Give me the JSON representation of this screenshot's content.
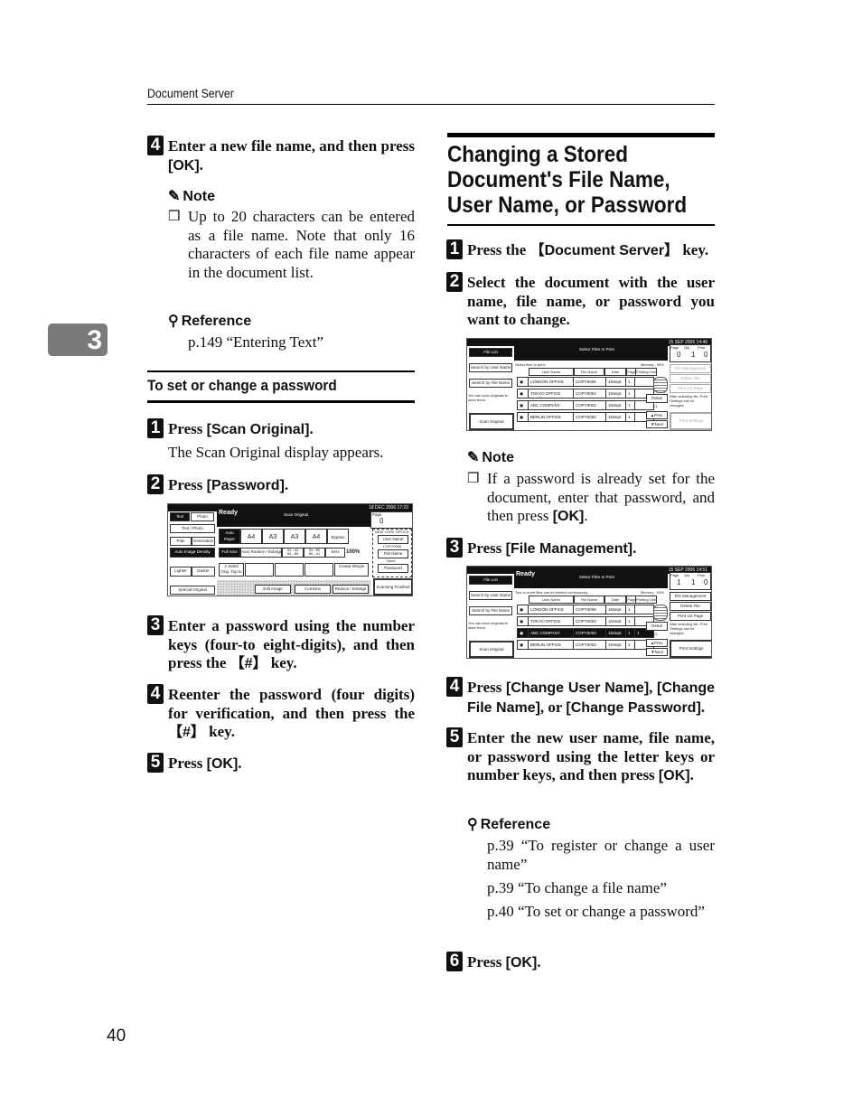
{
  "header": {
    "section": "Document Server"
  },
  "chapter_tab": "3",
  "page_number": "40",
  "left": {
    "step4": {
      "num": "4",
      "text": "Enter a new file name, and then press ",
      "key": "[OK]",
      "end": "."
    },
    "note": {
      "label": "Note",
      "text": "Up to 20 characters can be entered as a file name. Note that only 16 characters of each file name appear in the document list."
    },
    "reference": {
      "label": "Reference",
      "text": "p.149 “Entering Text”"
    },
    "subheading": "To set or change a password",
    "steps": [
      {
        "num": "1",
        "pre": "Press ",
        "key": "[Scan Original]",
        "post": ".",
        "sub": "The Scan Original display appears."
      },
      {
        "num": "2",
        "pre": "Press ",
        "key": "[Password]",
        "post": "."
      },
      {
        "num": "3",
        "text": "Enter a password using the number keys (four-to eight-digits), and then press the ",
        "key": "【#】",
        "post": " key."
      },
      {
        "num": "4",
        "text": "Reenter the password (four digits) for verification, and then press the ",
        "key": "【#】",
        "post": " key."
      },
      {
        "num": "5",
        "pre": "Press ",
        "key": "[OK]",
        "post": "."
      }
    ],
    "screen": {
      "datetime": "18 DEC 2006 17:23",
      "status": "Ready",
      "title": "Scan Original",
      "page_label": "Page",
      "page_value": "0",
      "buttons": {
        "text": "Text",
        "photo": "Photo",
        "text_photo": "Text / Photo",
        "pale": "Pale",
        "generation": "Generation",
        "auto_density": "Auto Image Density",
        "lighter": "Lighter",
        "darker": "Darker",
        "special": "Special Original",
        "auto_paper": "Auto Paper Select",
        "tray1": "A4",
        "tray2": "A3",
        "tray3": "A3",
        "tray4": "A4",
        "bypass": "Bypass",
        "full_size": "Full Size",
        "auto_reduce": "Auto Reduce / Enlarge",
        "r1": "A3→A4 B4→B5",
        "r2": "A4→B5 B5→A4",
        "r3": "93%",
        "ratio": "100%",
        "sided": "2 Sided Orig. Top to Top",
        "create_margin": "Create Margin",
        "edit_image": "Edit Image",
        "combine": "Combine",
        "reduce_enlarge": "Reduce / Enlarge",
        "office": "NEW YORK OFFICE",
        "user_name": "User Name",
        "copy_file": "COPY0006",
        "file_name": "File Name",
        "none": "None",
        "password": "Password",
        "scanning_finished": "Scanning Finished"
      }
    }
  },
  "right": {
    "title": "Changing a Stored Document's File Name, User Name, or Password",
    "steps": [
      {
        "num": "1",
        "pre": "Press the ",
        "key": "【Document Server】",
        "post": " key."
      },
      {
        "num": "2",
        "text": "Select the document with the user name, file name, or password you want to change."
      },
      {
        "num": "3",
        "pre": "Press ",
        "key": "[File Management]",
        "post": "."
      },
      {
        "num": "4",
        "pre": "Press ",
        "key": "[Change User Name]",
        "mid1": ", ",
        "key2": "[Change File Name]",
        "mid2": ", or ",
        "key3": "[Change Password]",
        "post": "."
      },
      {
        "num": "5",
        "text": "Enter the new user name, file name, or password using the letter keys or number keys, and then press ",
        "key": "[OK]",
        "post": "."
      },
      {
        "num": "6",
        "pre": "Press ",
        "key": "[OK]",
        "post": "."
      }
    ],
    "note": {
      "label": "Note",
      "text": "If a password is already set for the document, enter that password, and then press ",
      "key": "[OK]",
      "post": "."
    },
    "reference": {
      "label": "Reference",
      "items": [
        "p.39 “To register or change a user name”",
        "p.39 “To change a file name”",
        "p.40 “To set or change a password”"
      ]
    },
    "screen1": {
      "datetime": "15 SEP 2006 14:46",
      "file_list": "File List",
      "title": "Select Files to Print",
      "page_label": "Page",
      "qty_label": "Qty",
      "print_label": "Print",
      "page": "0",
      "qty": "1",
      "print": "0",
      "search_user": "Search by User Name",
      "search_file": "Search by File Name",
      "hint": "You can scan originals to store them.",
      "scan_original": "Scan Original",
      "msg": "Select files to print.",
      "memory": "Memory : 93%",
      "cols": [
        "User Name",
        "File Name",
        "Date",
        "Page",
        "Printing Order"
      ],
      "rows": [
        {
          "user": "LONDON OFFICE",
          "file": "COPY0006",
          "date": "15Sept.",
          "page": "1",
          "sel": false
        },
        {
          "user": "TOKYO OFFICE",
          "file": "COPY0004",
          "date": "15Sept.",
          "page": "1",
          "sel": false
        },
        {
          "user": "ABC COMPANY",
          "file": "COPY0003",
          "date": "15Sept.",
          "page": "1",
          "sel": false
        },
        {
          "user": "BERLIN OFFICE",
          "file": "COPY0002",
          "date": "15Sept.",
          "page": "1",
          "sel": false
        }
      ],
      "file_mgmt": "File Management",
      "delete_file": "Delete File",
      "print_first": "Print 1st Page",
      "detail": "Detail",
      "pager": "1/1",
      "prev": "▲Prev.",
      "next": "▼Next",
      "after": "After selecting file, Print Settings can be changed.",
      "print_settings": "Print Settings"
    },
    "screen2": {
      "datetime": "15 SEP 2006 14:51",
      "status": "Ready",
      "file_list": "File List",
      "title": "Select Files to Print",
      "page_label": "Page",
      "qty_label": "Qty",
      "print_label": "Print",
      "page": "1",
      "qty": "1",
      "print": "0",
      "search_user": "Search by User Name",
      "search_file": "Search by File Name",
      "hint": "You can scan originals to store them.",
      "scan_original": "Scan Original",
      "msg": "Two or more files can be printed continuously.",
      "memory": "Memory : 93%",
      "cols": [
        "User Name",
        "File Name",
        "Date",
        "Page",
        "Printing Order"
      ],
      "rows": [
        {
          "user": "LONDON OFFICE",
          "file": "COPY0006",
          "date": "15Sept.",
          "page": "1",
          "order": ""
        },
        {
          "user": "TOKYO OFFICE",
          "file": "COPY0004",
          "date": "15Sept.",
          "page": "1",
          "order": ""
        },
        {
          "user": "ABC COMPANY",
          "file": "COPY0003",
          "date": "15Sept.",
          "page": "1",
          "order": "1"
        },
        {
          "user": "BERLIN OFFICE",
          "file": "COPY0002",
          "date": "15Sept.",
          "page": "1",
          "order": ""
        }
      ],
      "file_mgmt": "File Management",
      "delete_file": "Delete File",
      "print_first": "Print 1st Page",
      "detail": "Detail",
      "pager": "1/1",
      "prev": "▲Prev.",
      "next": "▼Next",
      "after": "After selecting file, Print Settings can be changed.",
      "print_settings": "Print Settings"
    }
  }
}
